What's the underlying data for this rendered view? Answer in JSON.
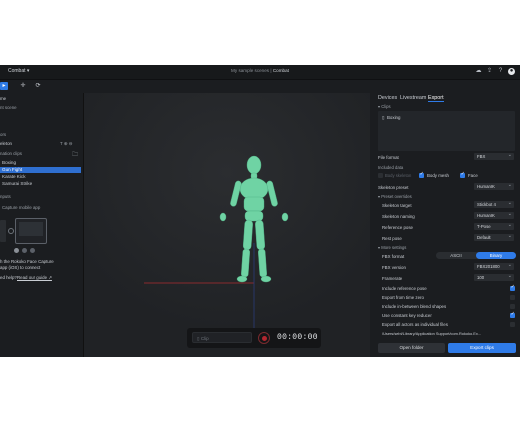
{
  "titlebar": {
    "scene_name": "Combat ▾",
    "breadcrumb_scene": "My sample scenes",
    "breadcrumb_sep": " | ",
    "breadcrumb_current": "Combat"
  },
  "left_panel": {
    "scene_label": "me",
    "scene_sub": "nt scene",
    "section_actors": "ors",
    "actor_name": "eleton",
    "actor_icons": "T  ⊕  ⊖",
    "animation_clips_label": "nation clips",
    "clips": [
      {
        "label": "Boxing",
        "selected": false
      },
      {
        "label": "Gun Fight",
        "selected": true
      },
      {
        "label": "Karate Kick",
        "selected": false
      },
      {
        "label": "Samurai Strike",
        "selected": false
      }
    ],
    "inputs_label": "nputs",
    "capture_note": "Capture mobile app",
    "connect_text_1": "h the Rokoko Face Capture",
    "connect_text_2": "app (iOS) to connect",
    "help_prefix": "ed help?",
    "help_link": "Read our guide ↗"
  },
  "viewport": {
    "clip_placeholder": "Clip",
    "timer": "00:00:00"
  },
  "right_panel": {
    "tabs": [
      "Devices",
      "Livestream",
      "Export"
    ],
    "active_tab": "Export",
    "clips_header": "▾ Clips",
    "clip_item": "Boxing",
    "file_format_label": "File format",
    "file_format_value": "FBX",
    "included_data_label": "Included data",
    "body_skeleton_label": "Body skeleton",
    "body_mesh_label": "Body mesh",
    "face_label": "Face",
    "skeleton_preset_label": "Skeleton preset",
    "skeleton_preset_value": "HumanIK",
    "preset_overrides_label": "▾ Preset overrides",
    "overrides": [
      {
        "label": "Skeleton target",
        "value": "Stickbot 4"
      },
      {
        "label": "Skeleton naming",
        "value": "HumanIK"
      },
      {
        "label": "Reference pose",
        "value": "T-Pose"
      },
      {
        "label": "Rest pose",
        "value": "Default"
      }
    ],
    "more_settings_label": "▾ More settings",
    "fbx_format_label": "FBX format",
    "fbx_format_options": [
      "ASCII",
      "Binary"
    ],
    "fbx_format_selected": "Binary",
    "fbx_version_label": "FBX version",
    "fbx_version_value": "FBX201800",
    "framerate_label": "Framerate",
    "framerate_value": "100",
    "checkbox_options": [
      {
        "label": "Include reference pose",
        "checked": true
      },
      {
        "label": "Export from time zero",
        "checked": false
      },
      {
        "label": "Include in-between blend shapes",
        "checked": false
      },
      {
        "label": "Use constant key reducer",
        "checked": true
      },
      {
        "label": "Export all actors as individual files",
        "checked": false
      }
    ],
    "export_path": "/Users/sebt/Library/Application Support/com.Rokoko.Ex...",
    "open_folder_label": "Open folder",
    "export_clips_label": "Export clips"
  },
  "colors": {
    "accent": "#2f7be8",
    "app_background": "#1b1d20",
    "viewport_background": "#232528",
    "mannequin": "#6fd3a4",
    "selected_row": "#2f6fd0",
    "record_red": "#b3262f"
  },
  "icons": {
    "cloud": "cloud-icon",
    "upload": "upload-icon",
    "help": "help-icon",
    "avatar": "avatar-icon",
    "move": "move-icon",
    "rotate": "rotate-icon",
    "folder": "folder-icon",
    "file": "file-icon"
  }
}
